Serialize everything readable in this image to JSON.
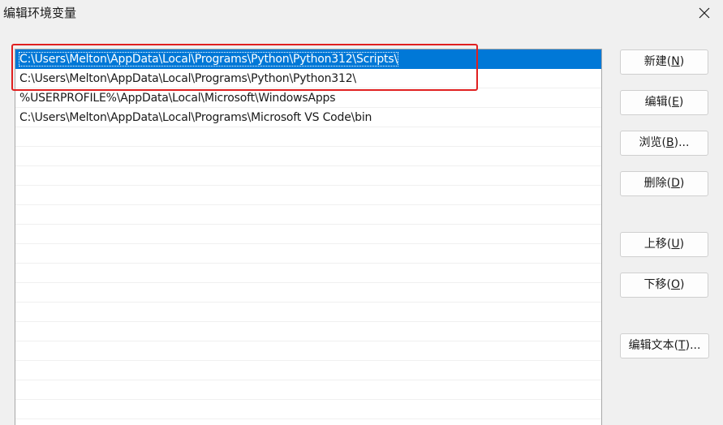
{
  "window": {
    "title": "编辑环境变量"
  },
  "path_list": [
    {
      "value": "C:\\Users\\Melton\\AppData\\Local\\Programs\\Python\\Python312\\Scripts\\",
      "selected": true
    },
    {
      "value": "C:\\Users\\Melton\\AppData\\Local\\Programs\\Python\\Python312\\",
      "selected": false
    },
    {
      "value": "%USERPROFILE%\\AppData\\Local\\Microsoft\\WindowsApps",
      "selected": false
    },
    {
      "value": "C:\\Users\\Melton\\AppData\\Local\\Programs\\Microsoft VS Code\\bin",
      "selected": false
    }
  ],
  "buttons": {
    "new": {
      "label": "新建(",
      "mnemonic": "N",
      "suffix": ")"
    },
    "edit": {
      "label": "编辑(",
      "mnemonic": "E",
      "suffix": ")"
    },
    "browse": {
      "label": "浏览(",
      "mnemonic": "B",
      "suffix": ")..."
    },
    "delete": {
      "label": "删除(",
      "mnemonic": "D",
      "suffix": ")"
    },
    "move_up": {
      "label": "上移(",
      "mnemonic": "U",
      "suffix": ")"
    },
    "move_down": {
      "label": "下移(",
      "mnemonic": "O",
      "suffix": ")"
    },
    "edit_text": {
      "label": "编辑文本(",
      "mnemonic": "T",
      "suffix": ")..."
    }
  },
  "colors": {
    "selection": "#0078d7",
    "annotation_border": "#e02020"
  }
}
